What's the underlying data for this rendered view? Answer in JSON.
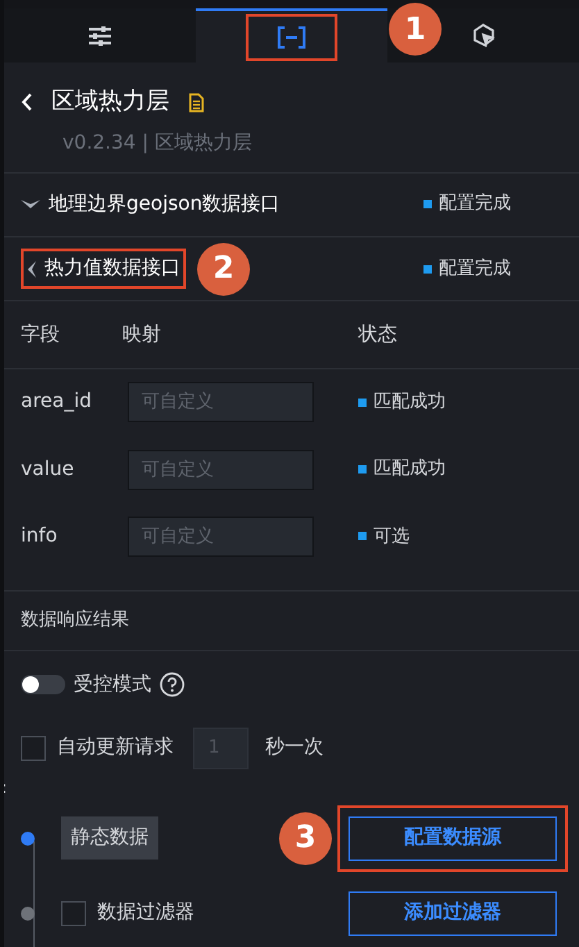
{
  "tabs": [
    {
      "kind": "sliders",
      "selected": false
    },
    {
      "kind": "brackets",
      "selected": true,
      "callout": "1"
    },
    {
      "kind": "cursor",
      "selected": false
    }
  ],
  "header": {
    "title": "区域热力层",
    "subtitle": "v0.2.34 | 区域热力层"
  },
  "sections": [
    {
      "label": "地理边界geojson数据接口",
      "expanded": true,
      "status": "配置完成"
    },
    {
      "label": "热力值数据接口",
      "expanded": false,
      "status": "配置完成",
      "callout": "2"
    }
  ],
  "field_table": {
    "columns": [
      "字段",
      "映射",
      "状态"
    ],
    "rows": [
      {
        "field": "area_id",
        "placeholder": "可自定义",
        "status": "匹配成功"
      },
      {
        "field": "value",
        "placeholder": "可自定义",
        "status": "匹配成功"
      },
      {
        "field": "info",
        "placeholder": "可自定义",
        "status": "可选"
      }
    ]
  },
  "response_title": "数据响应结果",
  "controlled_mode": {
    "label": "受控模式",
    "on": false
  },
  "auto_update": {
    "label": "自动更新请求",
    "checked": false,
    "interval": "1",
    "unit": "秒一次"
  },
  "side_mark": ":",
  "pipeline": [
    {
      "kind": "tag",
      "label": "静态数据",
      "active": true,
      "button": "配置数据源",
      "callout": "3"
    },
    {
      "kind": "checkbox",
      "label": "数据过滤器",
      "active": false,
      "checked": false,
      "button": "添加过滤器"
    }
  ]
}
